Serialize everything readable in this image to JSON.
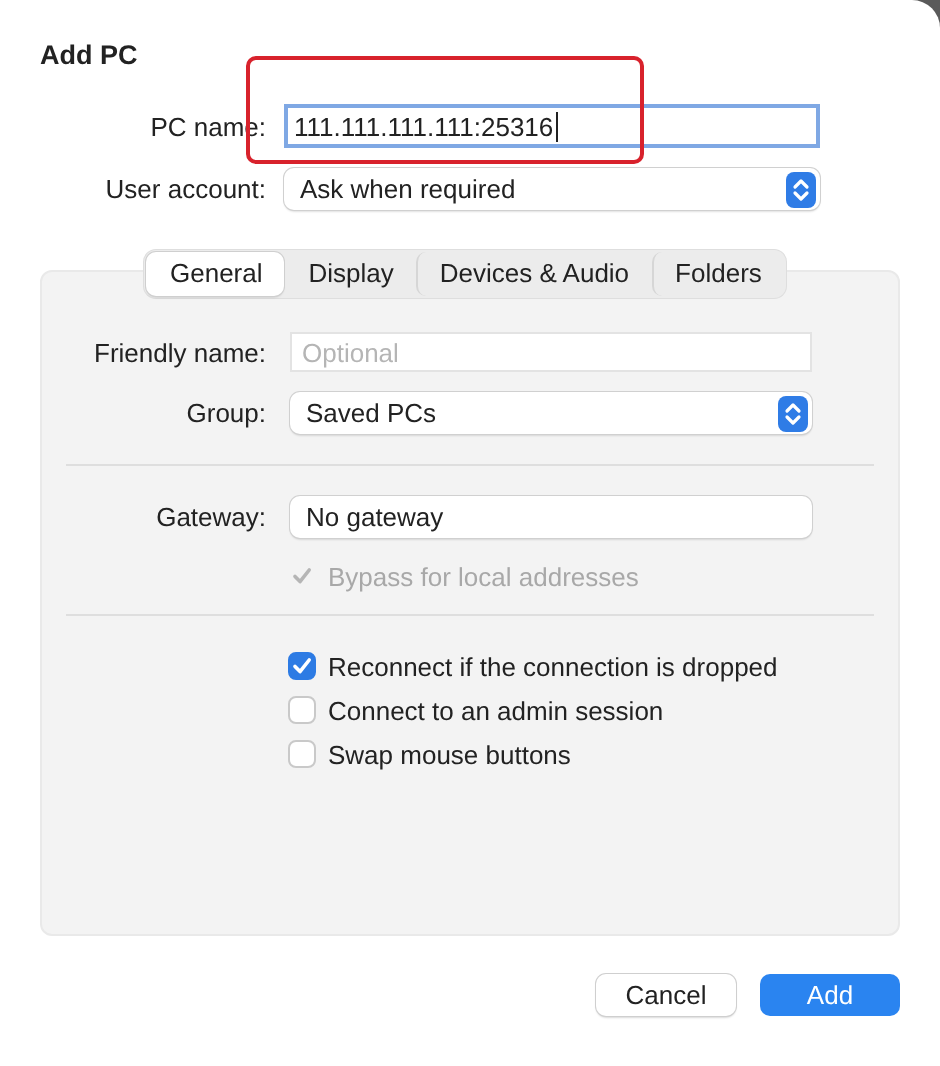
{
  "title": "Add PC",
  "pc_name": {
    "label": "PC name:",
    "value": "111.111.111.111:25316",
    "focused": true
  },
  "user_account": {
    "label": "User account:",
    "value": "Ask when required"
  },
  "tabs": [
    {
      "label": "General",
      "selected": true
    },
    {
      "label": "Display",
      "selected": false
    },
    {
      "label": "Devices & Audio",
      "selected": false
    },
    {
      "label": "Folders",
      "selected": false
    }
  ],
  "friendly_name": {
    "label": "Friendly name:",
    "placeholder": "Optional"
  },
  "group": {
    "label": "Group:",
    "value": "Saved PCs"
  },
  "gateway": {
    "label": "Gateway:",
    "value": "No gateway"
  },
  "bypass": {
    "label": "Bypass for local addresses",
    "checked": true,
    "disabled": true
  },
  "options": [
    {
      "label": "Reconnect if the connection is dropped",
      "checked": true
    },
    {
      "label": "Connect to an admin session",
      "checked": false
    },
    {
      "label": "Swap mouse buttons",
      "checked": false
    }
  ],
  "buttons": [
    {
      "label": "Cancel",
      "kind": "secondary"
    },
    {
      "label": "Add",
      "kind": "primary"
    }
  ],
  "annotation": {
    "kind": "frame"
  }
}
